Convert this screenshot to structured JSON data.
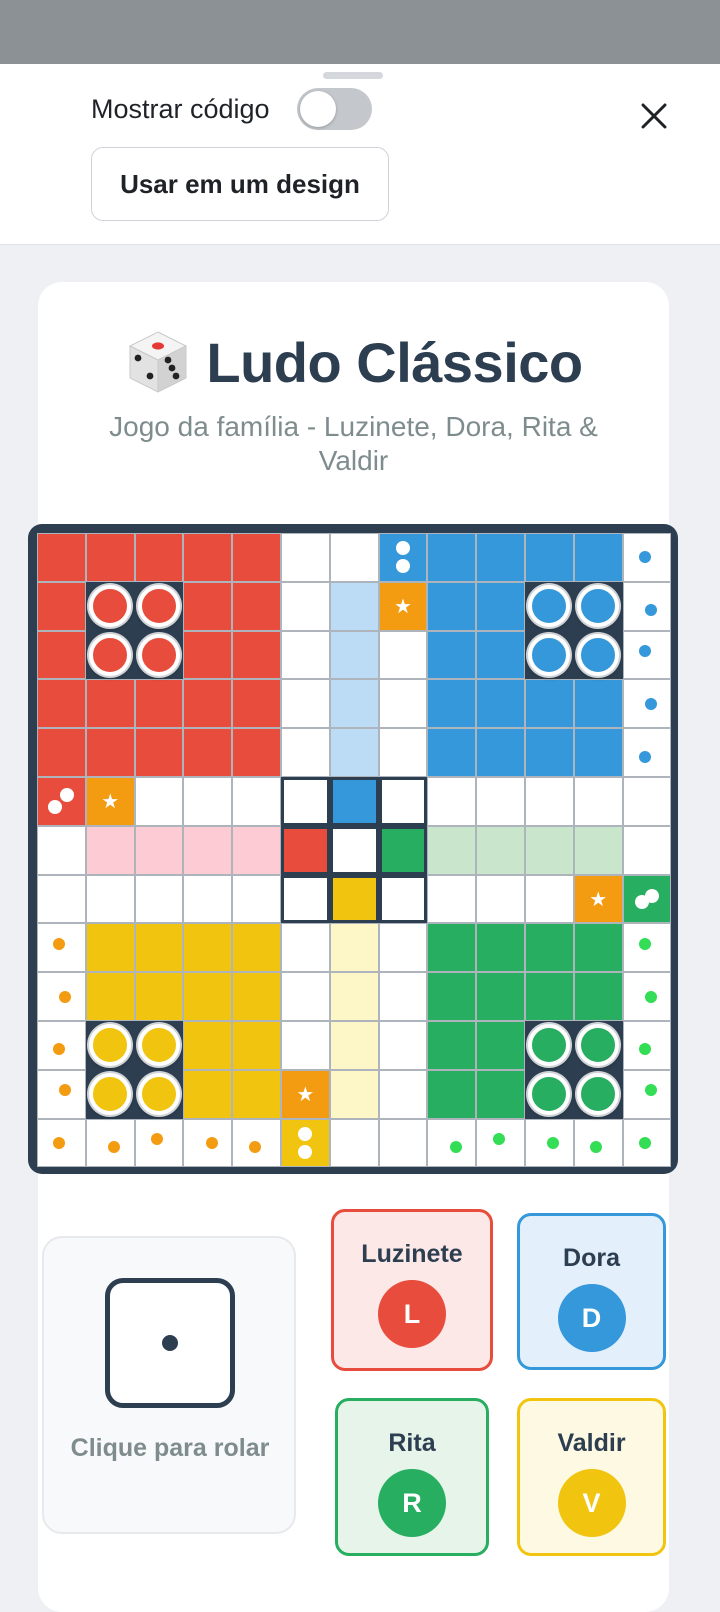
{
  "toolbar": {
    "show_code_label": "Mostrar código",
    "show_code_on": false,
    "use_in_design_label": "Usar em um design",
    "close_icon": "close-icon"
  },
  "game": {
    "title": "Ludo Clássico",
    "title_icon": "dice-icon",
    "subtitle": "Jogo da família - Luzinete, Dora, Rita & Valdir",
    "dice": {
      "value": 1,
      "caption": "Clique para rolar"
    },
    "players": [
      {
        "name": "Luzinete",
        "initial": "L",
        "color": "#e74c3c",
        "bg": "#fde8e8"
      },
      {
        "name": "Dora",
        "initial": "D",
        "color": "#3498db",
        "bg": "#e3f0fb"
      },
      {
        "name": "Rita",
        "initial": "R",
        "color": "#27ae60",
        "bg": "#e6f4ea"
      },
      {
        "name": "Valdir",
        "initial": "V",
        "color": "#f1c40f",
        "bg": "#fef9e3"
      }
    ]
  },
  "board": {
    "grid": 13,
    "colors": {
      "red": "#e74c3c",
      "blue": "#3498db",
      "green": "#27ae60",
      "yellow": "#f1c40f",
      "orange": "#f39c12",
      "red_light": "#fccbd3",
      "blue_light": "#bcdcf6",
      "green_light": "#c9e6cd",
      "yellow_light": "#fdf6c6",
      "frame": "#2c3e50"
    },
    "safe_squares_icon": "star-icon"
  }
}
